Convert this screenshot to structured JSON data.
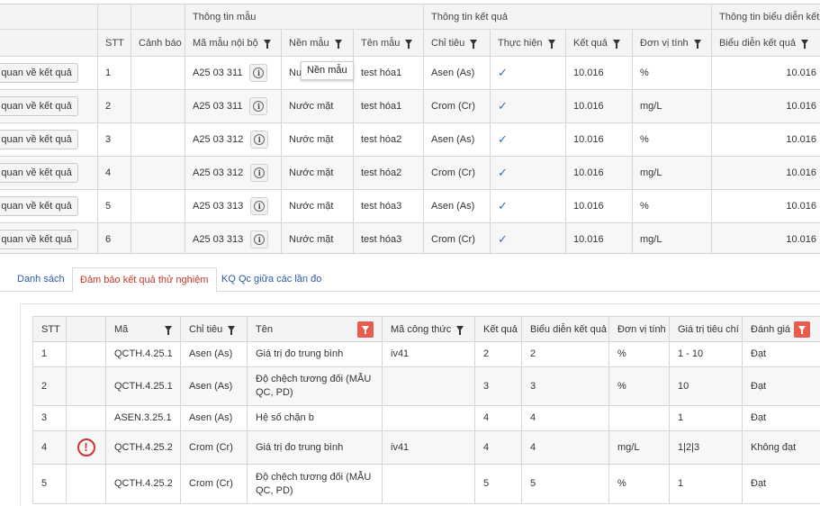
{
  "top": {
    "groups": {
      "sample": "Thông tin mẫu",
      "result": "Thông tin kết quả",
      "display": "Thông tin biểu diễn kết q"
    },
    "columns": {
      "stt": "STT",
      "warning": "Cảnh báo",
      "sample_code": "Mã mẫu nội bộ",
      "matrix": "Nền mẫu",
      "sample_name": "Tên mẫu",
      "indicator": "Chỉ tiêu",
      "performed": "Thực hiện",
      "result": "Kết quả",
      "unit": "Đơn vị tính",
      "display_result": "Biểu diễn kết quả"
    },
    "overview_label": "ổng quan về kết quả",
    "tooltip": "Nền mẫu",
    "check_icon": "check-icon",
    "rows": [
      {
        "stt": "1",
        "code": "A25 03 311",
        "matrix": "Nu",
        "name": "test hóa1",
        "indicator": "Asen (As)",
        "result": "10.016",
        "unit": "%",
        "display": "10.016"
      },
      {
        "stt": "2",
        "code": "A25 03 311",
        "matrix": "Nước mặt",
        "name": "test hóa1",
        "indicator": "Crom (Cr)",
        "result": "10.016",
        "unit": "mg/L",
        "display": "10.016"
      },
      {
        "stt": "3",
        "code": "A25 03 312",
        "matrix": "Nước mặt",
        "name": "test hóa2",
        "indicator": "Asen (As)",
        "result": "10.016",
        "unit": "%",
        "display": "10.016"
      },
      {
        "stt": "4",
        "code": "A25 03 312",
        "matrix": "Nước mặt",
        "name": "test hóa2",
        "indicator": "Crom (Cr)",
        "result": "10.016",
        "unit": "mg/L",
        "display": "10.016"
      },
      {
        "stt": "5",
        "code": "A25 03 313",
        "matrix": "Nước mặt",
        "name": "test hóa3",
        "indicator": "Asen (As)",
        "result": "10.016",
        "unit": "%",
        "display": "10.016"
      },
      {
        "stt": "6",
        "code": "A25 03 313",
        "matrix": "Nước mặt",
        "name": "test hóa3",
        "indicator": "Crom (Cr)",
        "result": "10.016",
        "unit": "mg/L",
        "display": "10.016"
      }
    ]
  },
  "tabs": [
    {
      "label": "Danh sách",
      "active": false
    },
    {
      "label": "Đảm bảo kết quả thử nghiệm",
      "active": true
    },
    {
      "label": "KQ Qc giữa các lần đo",
      "active": false
    }
  ],
  "bottom": {
    "columns": {
      "stt": "STT",
      "code": "Mã",
      "indicator": "Chỉ tiêu",
      "name": "Tên",
      "formula": "Mã công thức",
      "result": "Kết quả",
      "display": "Biểu diễn kết quả",
      "unit": "Đơn vị tính",
      "criteria": "Giá trị tiêu chí",
      "evaluation": "Đánh giá"
    },
    "warning_icon": "exclamation-icon",
    "rows": [
      {
        "stt": "1",
        "warn": false,
        "code": "QCTH.4.25.1",
        "indicator": "Asen (As)",
        "name": "Giá trị đo trung bình",
        "formula": "iv41",
        "result": "2",
        "display": "2",
        "unit": "%",
        "criteria": "1 - 10",
        "eval": "Đạt"
      },
      {
        "stt": "2",
        "warn": false,
        "code": "QCTH.4.25.1",
        "indicator": "Asen (As)",
        "name": "Độ chệch tương đối (MẪU QC, PD)",
        "formula": "",
        "result": "3",
        "display": "3",
        "unit": "%",
        "criteria": "10",
        "eval": "Đạt"
      },
      {
        "stt": "3",
        "warn": false,
        "code": "ASEN.3.25.1",
        "indicator": "Asen (As)",
        "name": "Hệ số chặn b",
        "formula": "",
        "result": "4",
        "display": "4",
        "unit": "",
        "criteria": "1",
        "eval": "Đạt"
      },
      {
        "stt": "4",
        "warn": true,
        "code": "QCTH.4.25.2",
        "indicator": "Crom (Cr)",
        "name": "Giá trị đo trung bình",
        "formula": "iv41",
        "result": "4",
        "display": "4",
        "unit": "mg/L",
        "criteria": "1|2|3",
        "eval": "Không đạt"
      },
      {
        "stt": "5",
        "warn": false,
        "code": "QCTH.4.25.2",
        "indicator": "Crom (Cr)",
        "name": "Độ chệch tương đối (MẪU QC, PD)",
        "formula": "",
        "result": "5",
        "display": "5",
        "unit": "%",
        "criteria": "1",
        "eval": "Đạt"
      }
    ]
  }
}
